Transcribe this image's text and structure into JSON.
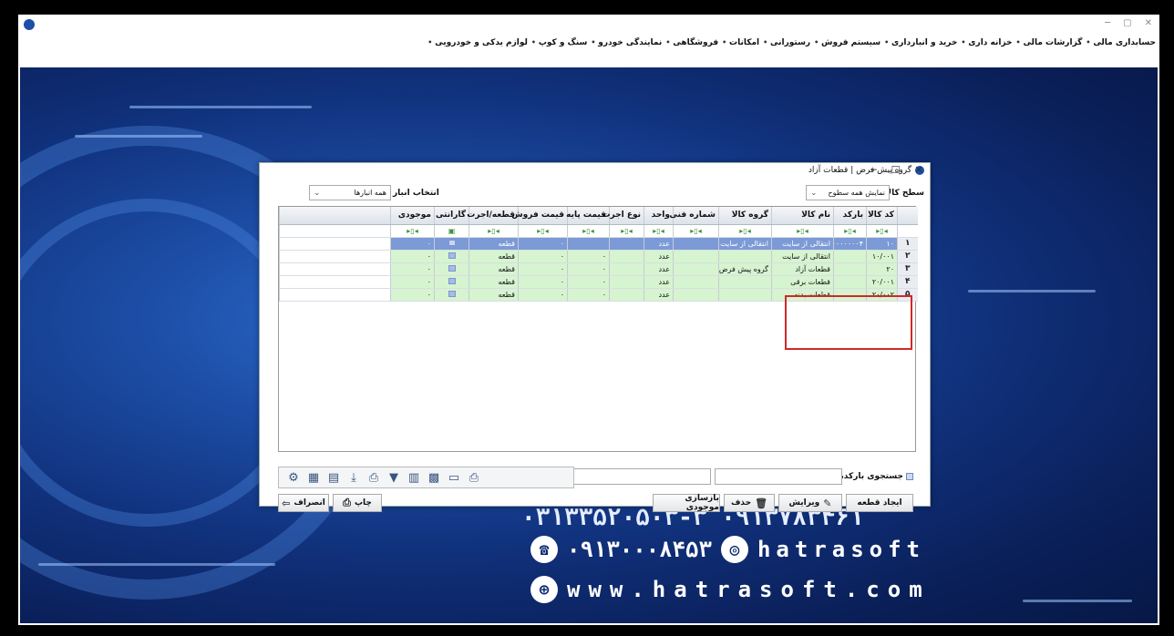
{
  "menu": {
    "line1": [
      "حسابداری مالی",
      "گزارشات مالی",
      "خزانه داری",
      "خرید و انبارداری",
      "سیستم فروش",
      "رستورانی",
      "امکانات",
      "فروشگاهی",
      "نمایندگی خودرو",
      "سنگ و کوپ",
      "لوازم یدکی و خودرویی"
    ]
  },
  "contact": {
    "phone_line": "۰۳۱۳۳۵۲۰۵۰۳-۳  ۰۹۱۳۷۸۳۴۶۱",
    "mobile": "۰۹۱۳۰۰۰۸۴۵۳",
    "instagram": "hatrasoft",
    "website": "www.hatrasoft.com"
  },
  "dialog": {
    "title": "گروه پیش فرض | قطعات آزاد",
    "level_label": "سطح کالا :",
    "level_value": "نمایش همه سطوح",
    "warehouse_label": "انتخاب انبار",
    "warehouse_value": "همه انبارها"
  },
  "grid": {
    "columns": [
      "کد کالا",
      "بارکد",
      "نام کالا",
      "گروه کالا",
      "شماره فنی",
      "واحد",
      "نوع اجرت",
      "قیمت پایه",
      "قیمت فروش",
      "قطعه/اجرت",
      "گارانتی",
      "موجودی"
    ],
    "rows": [
      {
        "num": "۱",
        "code": "۱۰",
        "barcode": "۲۲۰۰۰۰۰۰۰۴",
        "name": "انتقالی از سایت",
        "group": "انتقالی از سایت",
        "tech": "",
        "unit": "عدد",
        "wage": "",
        "base": "",
        "sale": "۰",
        "part": "قطعه",
        "warranty": "",
        "stock": "۰",
        "style": "selected"
      },
      {
        "num": "۲",
        "code": "۱۰/۰۰۱",
        "barcode": "",
        "name": "انتقالی از سایت",
        "group": "",
        "tech": "",
        "unit": "عدد",
        "wage": "",
        "base": "۰",
        "sale": "۰",
        "part": "قطعه",
        "warranty": "",
        "stock": "۰",
        "style": "green"
      },
      {
        "num": "۳",
        "code": "۲۰",
        "barcode": "",
        "name": "قطعات آزاد",
        "group": "گروه پیش فرض",
        "tech": "",
        "unit": "عدد",
        "wage": "",
        "base": "۰",
        "sale": "۰",
        "part": "قطعه",
        "warranty": "",
        "stock": "۰",
        "style": "green"
      },
      {
        "num": "۴",
        "code": "۲۰/۰۰۱",
        "barcode": "",
        "name": "قطعات برقی",
        "group": "",
        "tech": "",
        "unit": "عدد",
        "wage": "",
        "base": "۰",
        "sale": "۰",
        "part": "قطعه",
        "warranty": "",
        "stock": "۰",
        "style": "green"
      },
      {
        "num": "۵",
        "code": "۲۰/۰۰۲",
        "barcode": "",
        "name": "قطعات بدنه",
        "group": "",
        "tech": "",
        "unit": "عدد",
        "wage": "",
        "base": "۰",
        "sale": "۰",
        "part": "قطعه",
        "warranty": "",
        "stock": "۰",
        "style": "green"
      }
    ]
  },
  "search": {
    "label": "جستجوی بارکدها"
  },
  "buttons": {
    "create": "ایجاد قطعه",
    "edit": "ویرایش",
    "delete": "حذف",
    "rebuild": "بازسازی موجودی",
    "print": "چاپ",
    "cancel": "انصراف"
  }
}
